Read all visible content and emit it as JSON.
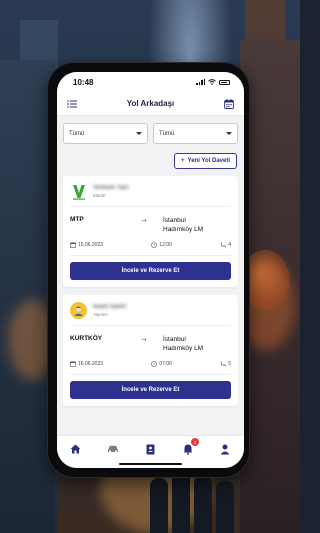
{
  "statusbar": {
    "time": "10:48"
  },
  "header": {
    "title": "Yol Arkadaşı"
  },
  "filters": [
    {
      "value": "Tümü"
    },
    {
      "value": "Tümü"
    }
  ],
  "new_invite": {
    "label": "Yeni Yol Daveti",
    "plus": "+"
  },
  "cards": [
    {
      "name": "Verbum Tasi",
      "role": "Müdür",
      "from": "MTP",
      "to_line1": "İstanbul",
      "to_line2": "Hadımköy LM",
      "date": "15.06.2023",
      "time": "12:00",
      "seats": "4",
      "action": "İncele ve Rezerve Et"
    },
    {
      "name": "Islam Sahin",
      "role": "Yapılım",
      "from": "KURTKÖY",
      "to_line1": "İstanbul",
      "to_line2": "Hadımköy LM",
      "date": "16.06.2023",
      "time": "07:00",
      "seats": "5",
      "action": "İncele ve Rezerve Et"
    }
  ],
  "tabbar": {
    "notifications_badge": "3"
  },
  "colors": {
    "primary": "#2e3190",
    "badge": "#e23b3b",
    "logo_green": "#3aa635"
  }
}
